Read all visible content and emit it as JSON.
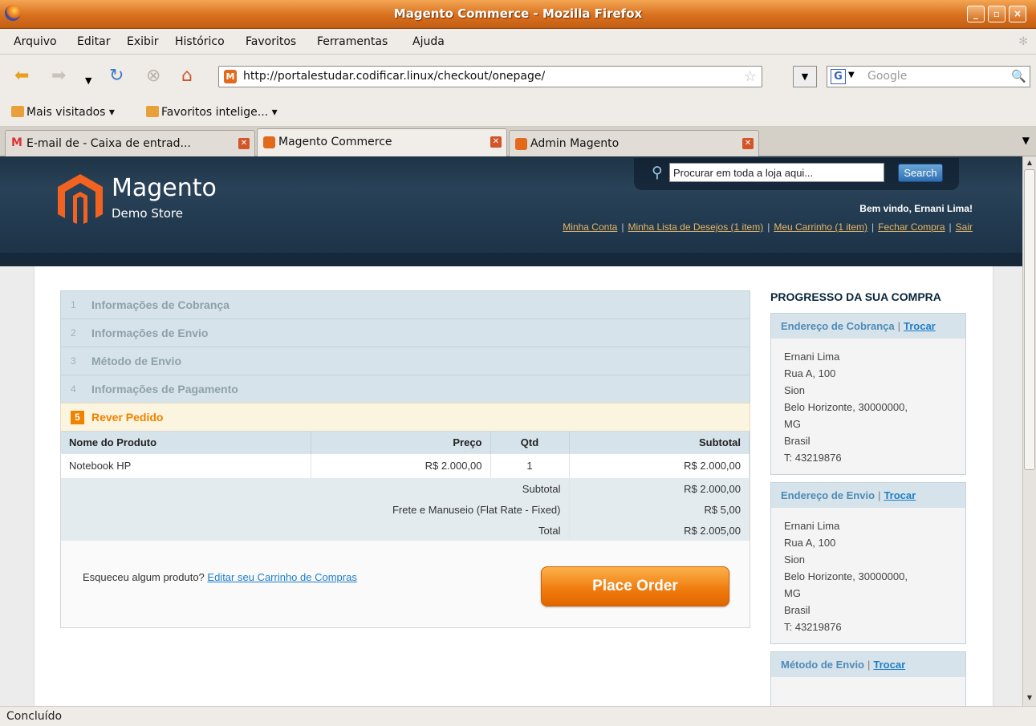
{
  "window": {
    "title": "Magento Commerce - Mozilla Firefox"
  },
  "menu": [
    "Arquivo",
    "Editar",
    "Exibir",
    "Histórico",
    "Favoritos",
    "Ferramentas",
    "Ajuda"
  ],
  "nav": {
    "url": "http://portalestudar.codificar.linux/checkout/onepage/",
    "search_placeholder": "Google"
  },
  "bookmarks": [
    "Mais visitados",
    "Favoritos intelige..."
  ],
  "tabs": [
    {
      "label": "E-mail de  - Caixa de entrad...",
      "active": false
    },
    {
      "label": "Magento Commerce",
      "active": true
    },
    {
      "label": "Admin Magento",
      "active": false
    }
  ],
  "store": {
    "logo": "Magento",
    "logo_sub": "Demo Store",
    "search_placeholder": "Procurar em toda a loja aqui...",
    "search_button": "Search",
    "welcome": "Bem vindo, Ernani Lima!",
    "links": [
      "Minha Conta",
      "Minha Lista de Desejos (1 item)",
      "Meu Carrinho (1 item)",
      "Fechar Compra",
      "Sair"
    ]
  },
  "steps": [
    {
      "num": "1",
      "label": "Informações de Cobrança"
    },
    {
      "num": "2",
      "label": "Informações de Envio"
    },
    {
      "num": "3",
      "label": "Método de Envio"
    },
    {
      "num": "4",
      "label": "Informações de Pagamento"
    },
    {
      "num": "5",
      "label": "Rever Pedido"
    }
  ],
  "order": {
    "headers": {
      "name": "Nome do Produto",
      "price": "Preço",
      "qty": "Qtd",
      "subtotal": "Subtotal"
    },
    "items": [
      {
        "name": "Notebook HP",
        "price": "R$ 2.000,00",
        "qty": "1",
        "subtotal": "R$ 2.000,00"
      }
    ],
    "totals": [
      {
        "label": "Subtotal",
        "value": "R$ 2.000,00"
      },
      {
        "label": "Frete e Manuseio (Flat Rate - Fixed)",
        "value": "R$ 5,00"
      },
      {
        "label": "Total",
        "value": "R$ 2.005,00"
      }
    ],
    "forgot_text": "Esqueceu algum produto?",
    "forgot_link": "Editar seu Carrinho de Compras",
    "place_order": "Place Order"
  },
  "progress": {
    "title": "PROGRESSO DA SUA COMPRA",
    "change": "Trocar",
    "billing_title": "Endereço de Cobrança",
    "billing_lines": [
      "Ernani Lima",
      "Rua A, 100",
      "Sion",
      "Belo Horizonte, 30000000,",
      "MG",
      "Brasil",
      "T: 43219876"
    ],
    "shipping_title": "Endereço de Envio",
    "shipping_lines": [
      "Ernani Lima",
      "Rua A, 100",
      "Sion",
      "Belo Horizonte, 30000000,",
      "MG",
      "Brasil",
      "T: 43219876"
    ],
    "method_title": "Método de Envio"
  },
  "status": "Concluído"
}
